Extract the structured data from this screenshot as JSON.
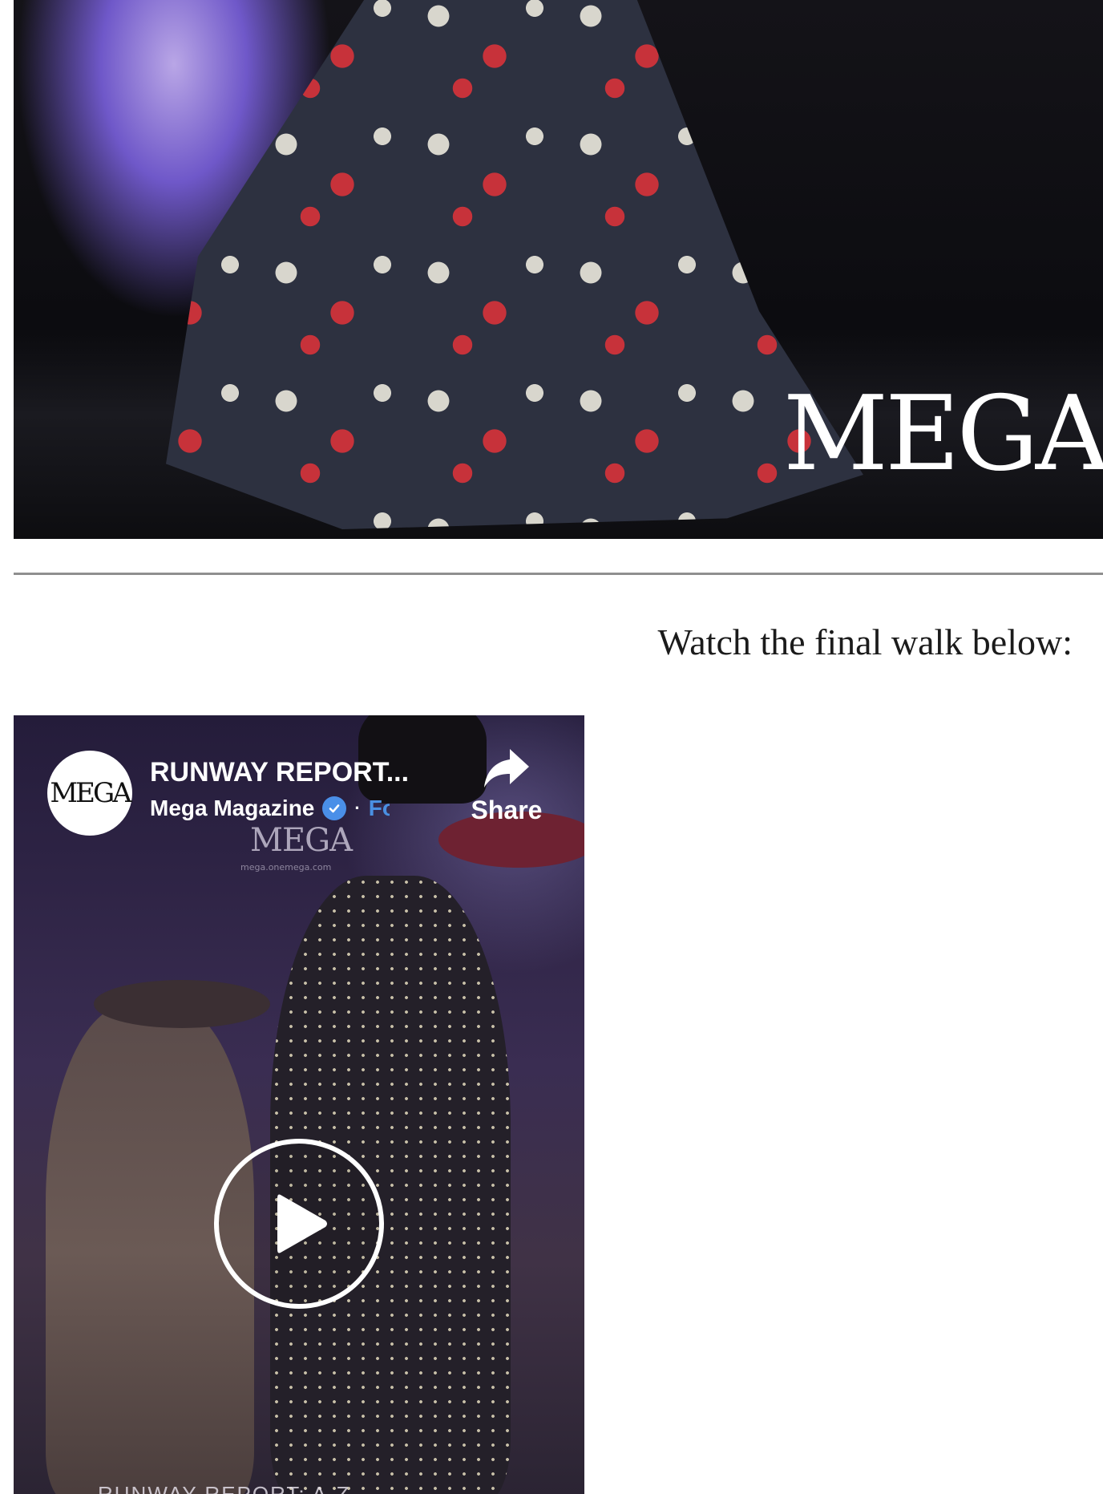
{
  "hero": {
    "watermark": "MEGA"
  },
  "article": {
    "caption": "Watch the final walk below:"
  },
  "video": {
    "channel_logo_text": "MEGA",
    "title": "RUNWAY REPORT...",
    "channel_name": "Mega Magazine",
    "separator": "·",
    "follow_label": "Follow",
    "share_label": "Share",
    "frame_watermark": "MEGA",
    "frame_watermark_sub": "mega.onemega.com",
    "bottom_caption": "RUNWAY REPORT: A-Z"
  },
  "colors": {
    "follow_link": "#4a90e2",
    "verified_badge": "#4a8fe8",
    "divider": "#8f8f8f",
    "caption_text": "#1b1b1b"
  },
  "icons": {
    "share": "share-arrow-icon",
    "verified": "verified-check-icon",
    "play": "play-icon"
  }
}
